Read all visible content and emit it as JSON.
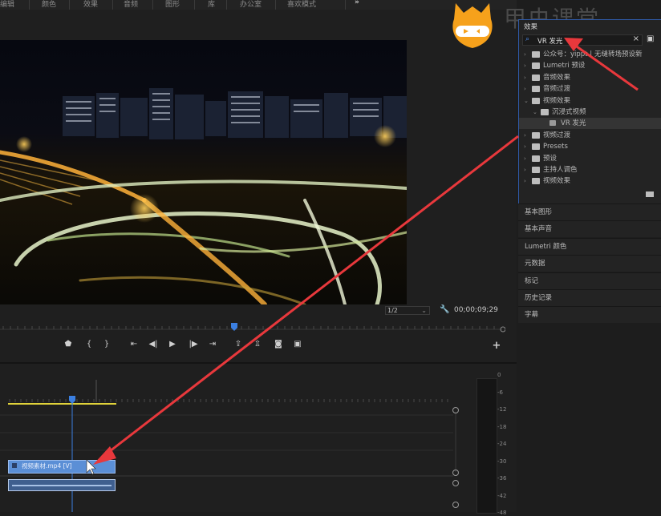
{
  "top_menu": [
    "编辑",
    "颜色",
    "效果",
    "音频",
    "图形",
    "库",
    "办公室",
    "喜欢模式",
    "»"
  ],
  "watermark": {
    "text": "甲虫课堂"
  },
  "program_monitor": {
    "zoom": "1/2",
    "timecode": "00;00;09;29"
  },
  "effects_panel": {
    "title": "效果",
    "search_value": "VR 发光",
    "clear_label": "×",
    "tree": [
      {
        "label": "公众号：yippt丨无缝转场预设新",
        "level": 0,
        "expanded": false
      },
      {
        "label": "Lumetri 预设",
        "level": 0,
        "expanded": false
      },
      {
        "label": "音频效果",
        "level": 0,
        "expanded": false
      },
      {
        "label": "音频过渡",
        "level": 0,
        "expanded": false
      },
      {
        "label": "视频效果",
        "level": 0,
        "expanded": true
      },
      {
        "label": "沉浸式视频",
        "level": 1,
        "expanded": true
      },
      {
        "label": "VR 发光",
        "level": 2,
        "item": true,
        "selected": true
      },
      {
        "label": "视频过渡",
        "level": 0,
        "expanded": false
      },
      {
        "label": "Presets",
        "level": 0,
        "expanded": false
      },
      {
        "label": "预设",
        "level": 0,
        "expanded": false
      },
      {
        "label": "主持人调色",
        "level": 0,
        "expanded": false
      },
      {
        "label": "视频效果",
        "level": 0,
        "expanded": false
      }
    ]
  },
  "side_panels": [
    "基本图形",
    "基本声音",
    "Lumetri 颜色",
    "元数据",
    "标记",
    "历史记录",
    "字幕"
  ],
  "timeline": {
    "clip_label": "视频素材.mp4 [V]"
  },
  "audio_meter": {
    "ticks": [
      "0",
      "-6",
      "-12",
      "-18",
      "-24",
      "-30",
      "-36",
      "-42",
      "-48"
    ]
  },
  "colors": {
    "accent": "#2f5aa8",
    "arrow": "#e8383c",
    "clip": "#5b8fd6",
    "playhead": "#3b7fe0"
  }
}
